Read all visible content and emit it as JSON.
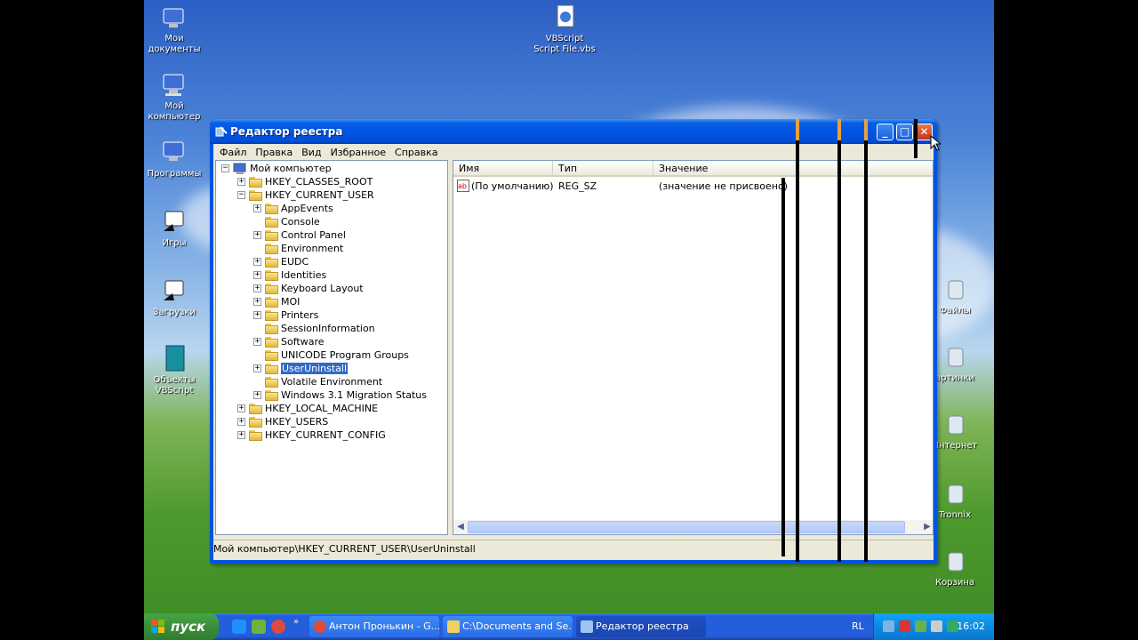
{
  "desktop": {
    "icons": [
      {
        "label": "Мои документы"
      },
      {
        "label": "Мой компьютер"
      },
      {
        "label": "Программы"
      },
      {
        "label": "Игры"
      },
      {
        "label": "Загрузки"
      },
      {
        "label": "Объекты VBScript"
      },
      {
        "label": "VBScript Script File.vbs"
      },
      {
        "label": "Файлы"
      },
      {
        "label": "артинки"
      },
      {
        "label": "Интернет"
      },
      {
        "label": "Tronnix"
      },
      {
        "label": "Корзина"
      }
    ]
  },
  "window": {
    "title": "Редактор реестра",
    "menu": [
      "Файл",
      "Правка",
      "Вид",
      "Избранное",
      "Справка"
    ],
    "tree": [
      {
        "label": "Мой компьютер",
        "level": 0,
        "expander": "−"
      },
      {
        "label": "HKEY_CLASSES_ROOT",
        "level": 1,
        "expander": "+"
      },
      {
        "label": "HKEY_CURRENT_USER",
        "level": 1,
        "expander": "−"
      },
      {
        "label": "AppEvents",
        "level": 2,
        "expander": "+"
      },
      {
        "label": "Console",
        "level": 2,
        "expander": ""
      },
      {
        "label": "Control Panel",
        "level": 2,
        "expander": "+"
      },
      {
        "label": "Environment",
        "level": 2,
        "expander": ""
      },
      {
        "label": "EUDC",
        "level": 2,
        "expander": "+"
      },
      {
        "label": "Identities",
        "level": 2,
        "expander": "+"
      },
      {
        "label": "Keyboard Layout",
        "level": 2,
        "expander": "+"
      },
      {
        "label": "MOI",
        "level": 2,
        "expander": "+"
      },
      {
        "label": "Printers",
        "level": 2,
        "expander": "+"
      },
      {
        "label": "SessionInformation",
        "level": 2,
        "expander": ""
      },
      {
        "label": "Software",
        "level": 2,
        "expander": "+"
      },
      {
        "label": "UNICODE Program Groups",
        "level": 2,
        "expander": ""
      },
      {
        "label": "UserUninstall",
        "level": 2,
        "expander": "+",
        "selected": true
      },
      {
        "label": "Volatile Environment",
        "level": 2,
        "expander": ""
      },
      {
        "label": "Windows 3.1 Migration Status",
        "level": 2,
        "expander": "+"
      },
      {
        "label": "HKEY_LOCAL_MACHINE",
        "level": 1,
        "expander": "+"
      },
      {
        "label": "HKEY_USERS",
        "level": 1,
        "expander": "+"
      },
      {
        "label": "HKEY_CURRENT_CONFIG",
        "level": 1,
        "expander": "+"
      }
    ],
    "list": {
      "columns": [
        "Имя",
        "Тип",
        "Значение"
      ],
      "rows": [
        {
          "name": "(По умолчанию)",
          "type": "REG_SZ",
          "value": "(значение не присвоено)"
        }
      ]
    },
    "status": "Мой компьютер\\HKEY_CURRENT_USER\\UserUninstall"
  },
  "taskbar": {
    "start_label": "пуск",
    "tasks": [
      {
        "label": "Антон Пронькин - G..."
      },
      {
        "label": "C:\\Documents and Se..."
      },
      {
        "label": "Редактор реестра"
      }
    ],
    "lang": "RL",
    "clock": "16:02"
  },
  "colors": {
    "titlebar": "#0054e3",
    "selection": "#316ac5",
    "start_button": "#3a8f3a"
  }
}
